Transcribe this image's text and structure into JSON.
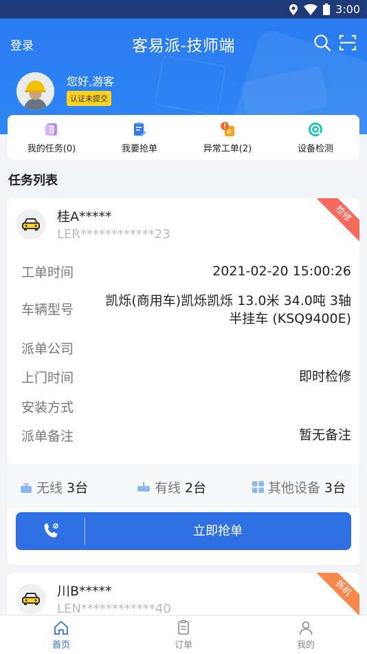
{
  "status_bar": {
    "time": "3:00"
  },
  "header": {
    "login_label": "登录",
    "title": "客易派-技师端",
    "greeting": "您好,游客",
    "cert_badge": "认证未提交"
  },
  "quick_actions": [
    {
      "label": "我的任务(0)",
      "icon": "tasks-icon"
    },
    {
      "label": "我要抢单",
      "icon": "grab-order-icon"
    },
    {
      "label": "异常工单(2)",
      "icon": "abnormal-order-icon"
    },
    {
      "label": "设备检测",
      "icon": "device-check-icon"
    }
  ],
  "section_title": "任务列表",
  "tasks": [
    {
      "plate": "桂A*****",
      "vin": "LER************23",
      "tag": "检修",
      "fields": [
        {
          "label": "工单时间",
          "value": "2021-02-20 15:00:26"
        },
        {
          "label": "车辆型号",
          "value_line1": "凯烁(商用车)凯烁凯烁 13.0米 34.0吨 3轴",
          "value_line2": "半挂车 (KSQ9400E)"
        },
        {
          "label": "派单公司",
          "value": ""
        },
        {
          "label": "上门时间",
          "value": "即时检修"
        },
        {
          "label": "安装方式",
          "value": ""
        },
        {
          "label": "派单备注",
          "value": "暂无备注"
        }
      ],
      "devices": [
        {
          "label": "无线",
          "count": "3台"
        },
        {
          "label": "有线",
          "count": "2台"
        },
        {
          "label": "其他设备",
          "count": "3台"
        }
      ],
      "grab_label": "立即抢单"
    },
    {
      "plate": "川B*****",
      "vin": "LEN************40",
      "tag": "拆机"
    }
  ],
  "bottom_nav": [
    {
      "label": "首页",
      "active": true
    },
    {
      "label": "订单",
      "active": false
    },
    {
      "label": "我的",
      "active": false
    }
  ],
  "colors": {
    "primary": "#2f6fe4",
    "header_blue": "#2a7cf0",
    "badge_yellow": "#ffd21f",
    "ribbon_red": "#f46a5b",
    "ribbon_orange": "#f6884a"
  }
}
